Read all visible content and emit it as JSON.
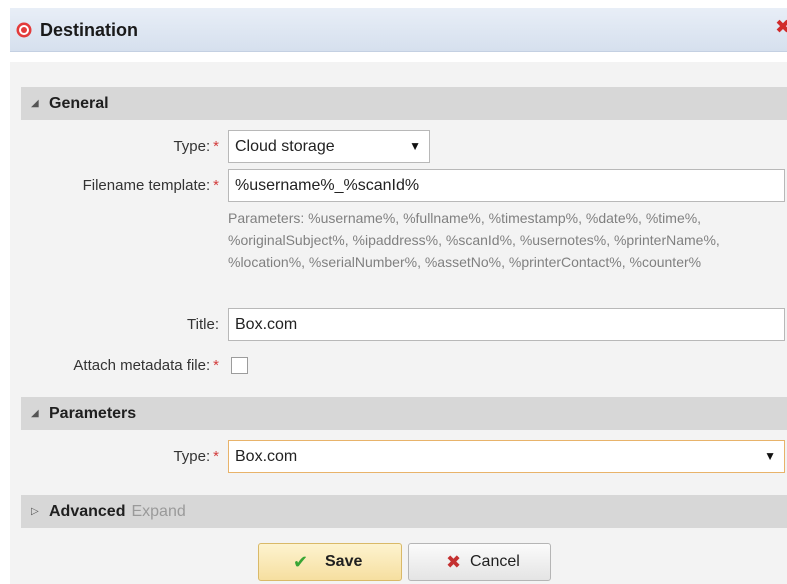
{
  "window": {
    "title": "Destination",
    "logo_icon": "target-icon",
    "close_icon": "close-icon"
  },
  "sections": {
    "general": {
      "title": "General",
      "collapse_icon": "triangle-down-icon"
    },
    "parameters": {
      "title": "Parameters",
      "collapse_icon": "triangle-down-icon"
    },
    "advanced": {
      "title": "Advanced",
      "expand_label": "Expand",
      "expand_icon": "triangle-right-icon"
    }
  },
  "general": {
    "type_label": "Type:",
    "type_value": "Cloud storage",
    "filename_label": "Filename template:",
    "filename_value": "%username%_%scanId%",
    "filename_hint": "Parameters: %username%, %fullname%, %timestamp%, %date%, %time%, %originalSubject%, %ipaddress%, %scanId%, %usernotes%, %printerName%, %location%, %serialNumber%, %assetNo%, %printerContact%, %counter%",
    "title_label": "Title:",
    "title_value": "Box.com",
    "metadata_label": "Attach metadata file:",
    "metadata_checked": false
  },
  "parameters": {
    "type_label": "Type:",
    "type_value": "Box.com"
  },
  "required_marker": "*",
  "caret": "▼",
  "buttons": {
    "save_label": "Save",
    "save_icon": "checkmark-icon",
    "cancel_label": "Cancel",
    "cancel_icon": "x-icon"
  },
  "colors": {
    "required": "#d23a3a",
    "section_header_bg": "#d7d7d7",
    "save_bg": "#f6dfa0",
    "focus_border": "#e8b36a"
  }
}
